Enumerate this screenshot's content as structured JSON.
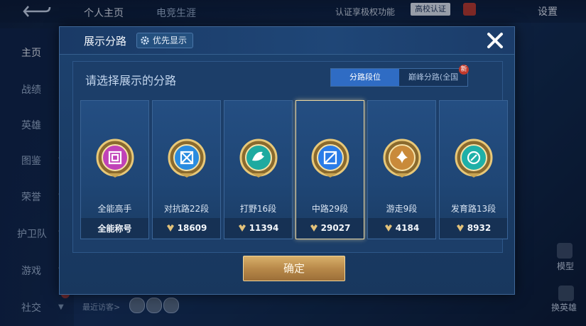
{
  "top_nav": {
    "tabs": [
      "个人主页",
      "电竞生涯"
    ],
    "auth_text": "认证享极权功能",
    "school_badge": "高校认证",
    "settings": "设置"
  },
  "sidebar": {
    "items": [
      {
        "label": "主页",
        "active": true
      },
      {
        "label": "战绩"
      },
      {
        "label": "英雄"
      },
      {
        "label": "图鉴"
      },
      {
        "label": "荣誉"
      },
      {
        "label": "护卫队"
      },
      {
        "label": "游戏"
      },
      {
        "label": "社交"
      }
    ]
  },
  "visitors_label": "最近访客>",
  "right_panel": {
    "model_label": "模型",
    "switch_hero_label": "换英雄"
  },
  "modal": {
    "title": "展示分路",
    "priority_label": "优先显示",
    "prompt": "请选择展示的分路",
    "segments": [
      {
        "label": "分路段位",
        "active": true
      },
      {
        "label": "巅峰分路(全国",
        "new_badge": "新"
      }
    ],
    "cards": [
      {
        "name": "全能高手",
        "value": "全能称号",
        "icon": "all-round-emblem-icon",
        "color": "#c042b8"
      },
      {
        "name": "对抗路22段",
        "value": "18609",
        "icon": "clash-lane-emblem-icon",
        "color": "#2a8ce0"
      },
      {
        "name": "打野16段",
        "value": "11394",
        "icon": "jungle-emblem-icon",
        "color": "#1faaa0"
      },
      {
        "name": "中路29段",
        "value": "29027",
        "icon": "mid-lane-emblem-icon",
        "color": "#2a7ce8",
        "selected": true
      },
      {
        "name": "游走9段",
        "value": "4184",
        "icon": "roam-emblem-icon",
        "color": "#c98a3a"
      },
      {
        "name": "发育路13段",
        "value": "8932",
        "icon": "farm-lane-emblem-icon",
        "color": "#1fb0a8"
      }
    ],
    "confirm_label": "确定"
  }
}
